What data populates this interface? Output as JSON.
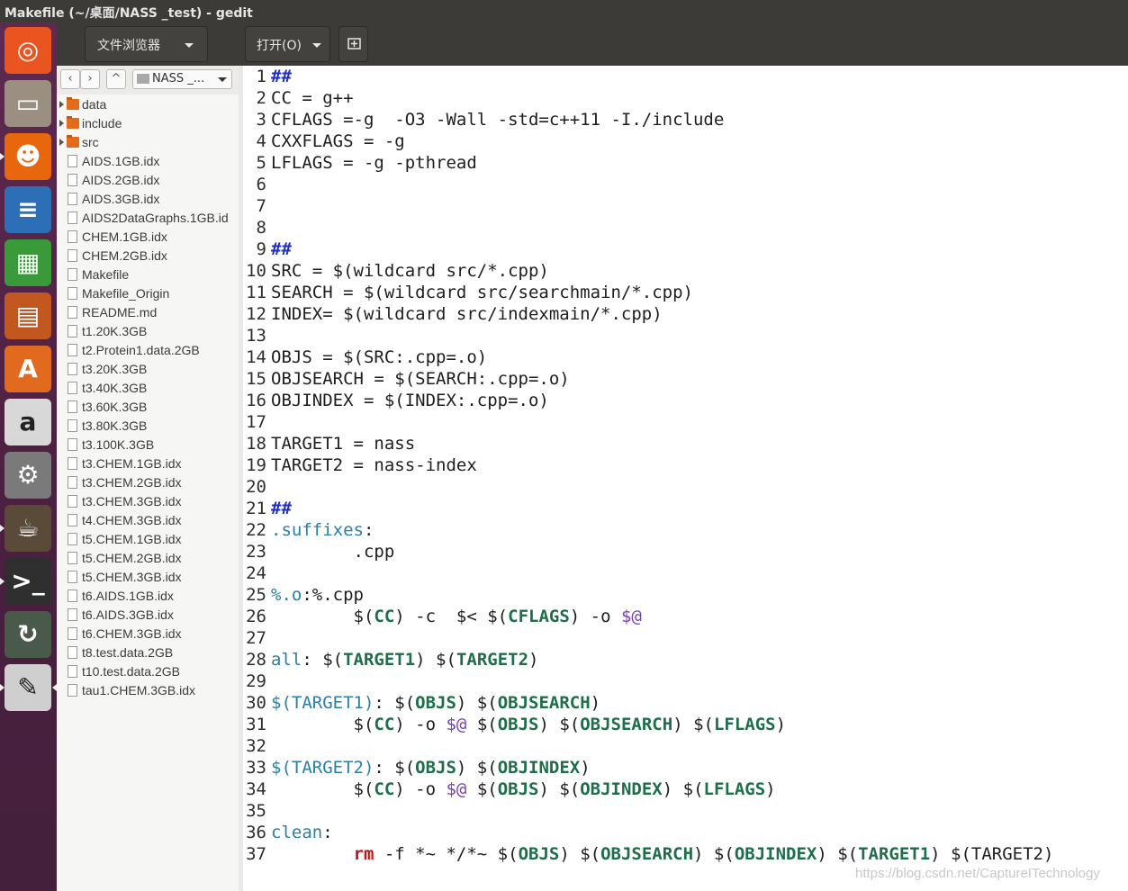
{
  "window": {
    "title": "Makefile (~/桌面/NASS _test) - gedit"
  },
  "toolbar": {
    "sidebar_mode": "文件浏览器",
    "open_label": "打开(O)"
  },
  "file_browser": {
    "location": "NASS _...",
    "items": [
      {
        "name": "data",
        "type": "folder"
      },
      {
        "name": "include",
        "type": "folder"
      },
      {
        "name": "src",
        "type": "folder"
      },
      {
        "name": "AIDS.1GB.idx",
        "type": "file"
      },
      {
        "name": "AIDS.2GB.idx",
        "type": "file"
      },
      {
        "name": "AIDS.3GB.idx",
        "type": "file"
      },
      {
        "name": "AIDS2DataGraphs.1GB.id",
        "type": "file"
      },
      {
        "name": "CHEM.1GB.idx",
        "type": "file"
      },
      {
        "name": "CHEM.2GB.idx",
        "type": "file"
      },
      {
        "name": "Makefile",
        "type": "file"
      },
      {
        "name": "Makefile_Origin",
        "type": "file"
      },
      {
        "name": "README.md",
        "type": "file"
      },
      {
        "name": "t1.20K.3GB",
        "type": "file"
      },
      {
        "name": "t2.Protein1.data.2GB",
        "type": "file"
      },
      {
        "name": "t3.20K.3GB",
        "type": "file"
      },
      {
        "name": "t3.40K.3GB",
        "type": "file"
      },
      {
        "name": "t3.60K.3GB",
        "type": "file"
      },
      {
        "name": "t3.80K.3GB",
        "type": "file"
      },
      {
        "name": "t3.100K.3GB",
        "type": "file"
      },
      {
        "name": "t3.CHEM.1GB.idx",
        "type": "file"
      },
      {
        "name": "t3.CHEM.2GB.idx",
        "type": "file"
      },
      {
        "name": "t3.CHEM.3GB.idx",
        "type": "file"
      },
      {
        "name": "t4.CHEM.3GB.idx",
        "type": "file"
      },
      {
        "name": "t5.CHEM.1GB.idx",
        "type": "file"
      },
      {
        "name": "t5.CHEM.2GB.idx",
        "type": "file"
      },
      {
        "name": "t5.CHEM.3GB.idx",
        "type": "file"
      },
      {
        "name": "t6.AIDS.1GB.idx",
        "type": "file"
      },
      {
        "name": "t6.AIDS.3GB.idx",
        "type": "file"
      },
      {
        "name": "t6.CHEM.3GB.idx",
        "type": "file"
      },
      {
        "name": "t8.test.data.2GB",
        "type": "file"
      },
      {
        "name": "t10.test.data.2GB",
        "type": "file"
      },
      {
        "name": "tau1.CHEM.3GB.idx",
        "type": "file"
      }
    ]
  },
  "launcher": {
    "apps": [
      {
        "name": "ubuntu-dash",
        "color": "#e95420"
      },
      {
        "name": "files",
        "color": "#9a8f80"
      },
      {
        "name": "firefox",
        "color": "#e8660c"
      },
      {
        "name": "writer",
        "color": "#2c6fb7"
      },
      {
        "name": "calc",
        "color": "#3a9a3a"
      },
      {
        "name": "impress",
        "color": "#c2571f"
      },
      {
        "name": "software-center",
        "color": "#e26a1e"
      },
      {
        "name": "amazon",
        "color": "#d8d8d8"
      },
      {
        "name": "system-settings",
        "color": "#7a7a7a"
      },
      {
        "name": "eclipse-java-ee",
        "color": "#5a4a3a"
      },
      {
        "name": "terminal",
        "color": "#2f2f2f"
      },
      {
        "name": "software-updater",
        "color": "#4a5a4a"
      },
      {
        "name": "text-editor",
        "color": "#cfcfcf"
      }
    ]
  },
  "editor": {
    "lines": [
      [
        {
          "t": "##",
          "c": "hash"
        }
      ],
      [
        {
          "t": "CC = g++"
        }
      ],
      [
        {
          "t": "CFLAGS =-g  -O3 -Wall -std=c++11 -I./include"
        }
      ],
      [
        {
          "t": "CXXFLAGS = -g"
        }
      ],
      [
        {
          "t": "LFLAGS = -g -pthread"
        }
      ],
      [],
      [],
      [],
      [
        {
          "t": "##",
          "c": "hash"
        }
      ],
      [
        {
          "t": "SRC = $(wildcard src/*.cpp)"
        }
      ],
      [
        {
          "t": "SEARCH = $(wildcard src/searchmain/*.cpp)"
        }
      ],
      [
        {
          "t": "INDEX= $(wildcard src/indexmain/*.cpp)"
        }
      ],
      [],
      [
        {
          "t": "OBJS = $(SRC:.cpp=.o)"
        }
      ],
      [
        {
          "t": "OBJSEARCH = $(SEARCH:.cpp=.o)"
        }
      ],
      [
        {
          "t": "OBJINDEX = $(INDEX:.cpp=.o)"
        }
      ],
      [],
      [
        {
          "t": "TARGET1 = nass"
        }
      ],
      [
        {
          "t": "TARGET2 = nass-index"
        }
      ],
      [],
      [
        {
          "t": "##",
          "c": "hash"
        }
      ],
      [
        {
          "t": ".suffixes",
          "c": "tgt"
        },
        {
          "t": ":"
        }
      ],
      [
        {
          "t": "        .cpp"
        }
      ],
      [],
      [
        {
          "t": "%",
          "c": "pct"
        },
        {
          "t": ".o",
          "c": "tgt"
        },
        {
          "t": ":%.cpp"
        }
      ],
      [
        {
          "t": "        $("
        },
        {
          "t": "CC",
          "c": "var"
        },
        {
          "t": ") -c  $< $("
        },
        {
          "t": "CFLAGS",
          "c": "var"
        },
        {
          "t": ") -o "
        },
        {
          "t": "$@",
          "c": "auto"
        }
      ],
      [],
      [
        {
          "t": "all",
          "c": "tgt"
        },
        {
          "t": ": $("
        },
        {
          "t": "TARGET1",
          "c": "var"
        },
        {
          "t": ") $("
        },
        {
          "t": "TARGET2",
          "c": "var"
        },
        {
          "t": ")"
        }
      ],
      [],
      [
        {
          "t": "$(TARGET1)",
          "c": "tgt"
        },
        {
          "t": ": $("
        },
        {
          "t": "OBJS",
          "c": "var"
        },
        {
          "t": ") $("
        },
        {
          "t": "OBJSEARCH",
          "c": "var"
        },
        {
          "t": ")"
        }
      ],
      [
        {
          "t": "        $("
        },
        {
          "t": "CC",
          "c": "var"
        },
        {
          "t": ") -o "
        },
        {
          "t": "$@",
          "c": "auto"
        },
        {
          "t": " $("
        },
        {
          "t": "OBJS",
          "c": "var"
        },
        {
          "t": ") $("
        },
        {
          "t": "OBJSEARCH",
          "c": "var"
        },
        {
          "t": ") $("
        },
        {
          "t": "LFLAGS",
          "c": "var"
        },
        {
          "t": ")"
        }
      ],
      [],
      [
        {
          "t": "$(TARGET2)",
          "c": "tgt"
        },
        {
          "t": ": $("
        },
        {
          "t": "OBJS",
          "c": "var"
        },
        {
          "t": ") $("
        },
        {
          "t": "OBJINDEX",
          "c": "var"
        },
        {
          "t": ")"
        }
      ],
      [
        {
          "t": "        $("
        },
        {
          "t": "CC",
          "c": "var"
        },
        {
          "t": ") -o "
        },
        {
          "t": "$@",
          "c": "auto"
        },
        {
          "t": " $("
        },
        {
          "t": "OBJS",
          "c": "var"
        },
        {
          "t": ") $("
        },
        {
          "t": "OBJINDEX",
          "c": "var"
        },
        {
          "t": ") $("
        },
        {
          "t": "LFLAGS",
          "c": "var"
        },
        {
          "t": ")"
        }
      ],
      [],
      [
        {
          "t": "clean",
          "c": "tgt"
        },
        {
          "t": ":"
        }
      ],
      [
        {
          "t": "        "
        },
        {
          "t": "rm",
          "c": "red"
        },
        {
          "t": " -f *~ */*~ $("
        },
        {
          "t": "OBJS",
          "c": "var"
        },
        {
          "t": ") $("
        },
        {
          "t": "OBJSEARCH",
          "c": "var"
        },
        {
          "t": ") $("
        },
        {
          "t": "OBJINDEX",
          "c": "var"
        },
        {
          "t": ") $("
        },
        {
          "t": "TARGET1",
          "c": "var"
        },
        {
          "t": ") $(TARGET2)"
        }
      ]
    ]
  },
  "watermark": "https://blog.csdn.net/CaptureITechnology"
}
